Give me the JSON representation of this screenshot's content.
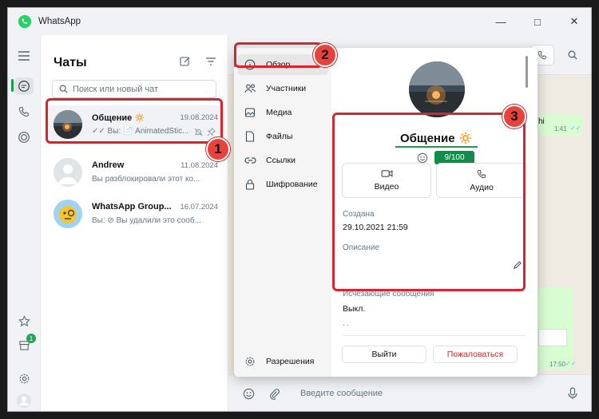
{
  "window": {
    "title": "WhatsApp"
  },
  "colors": {
    "accent": "#1a9e4d",
    "annotation_red": "#d5262f",
    "badge_fill": "#e8423c",
    "bubble": "#d9fdd3"
  },
  "rail": {
    "icons": [
      "menu-icon",
      "chats-icon",
      "calls-icon",
      "status-icon",
      "starred-icon",
      "archive-icon",
      "settings-icon",
      "profile-icon"
    ],
    "archive_badge": "1"
  },
  "chatlist": {
    "title": "Чаты",
    "search_placeholder": "Поиск или новый чат",
    "chats": [
      {
        "name": "Общение 🔅",
        "date": "19.08.2024",
        "preview": "✓✓ Вы: 📄 AnimatedStic..."
      },
      {
        "name": "Andrew",
        "date": "11.08.2024",
        "preview": "Вы разблокировали этот ко..."
      },
      {
        "name": "WhatsApp Group...",
        "date": "16.07.2024",
        "preview": "Вы: ⊘ Вы удалили это сооб..."
      }
    ]
  },
  "conversation": {
    "input_placeholder": "Введите сообщение",
    "time_1": "1:41",
    "time_2": "17:50",
    "partial_text": "hi"
  },
  "panel": {
    "nav": [
      {
        "label": "Обзор"
      },
      {
        "label": "Участники"
      },
      {
        "label": "Медиа"
      },
      {
        "label": "Файлы"
      },
      {
        "label": "Ссылки"
      },
      {
        "label": "Шифрование"
      }
    ],
    "settings_label": "Разрешения",
    "group_name": "Общение 🔅",
    "name_counter": "9/100",
    "video_label": "Видео",
    "audio_label": "Аудио",
    "created_label": "Создана",
    "created_value": "29.10.2021 21:59",
    "description_label": "Описание",
    "disappearing_label": "Исчезающие сообщения",
    "disappearing_value": "Выкл.",
    "exit_label": "Выйти",
    "report_label": "Пожаловаться"
  },
  "annotations": [
    "1",
    "2",
    "3"
  ]
}
